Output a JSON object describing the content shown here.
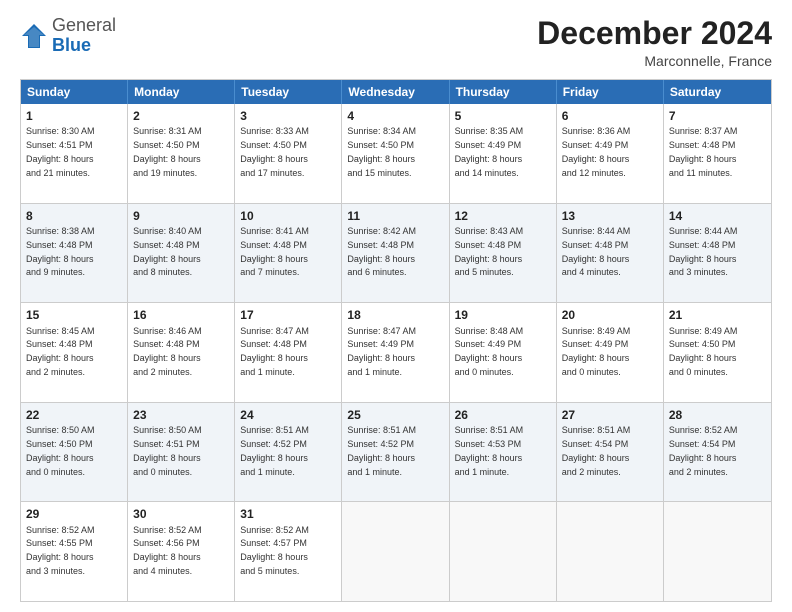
{
  "logo": {
    "general": "General",
    "blue": "Blue"
  },
  "header": {
    "month": "December 2024",
    "location": "Marconnelle, France"
  },
  "weekdays": [
    "Sunday",
    "Monday",
    "Tuesday",
    "Wednesday",
    "Thursday",
    "Friday",
    "Saturday"
  ],
  "rows": [
    [
      {
        "day": "1",
        "text": "Sunrise: 8:30 AM\nSunset: 4:51 PM\nDaylight: 8 hours\nand 21 minutes.",
        "shaded": false
      },
      {
        "day": "2",
        "text": "Sunrise: 8:31 AM\nSunset: 4:50 PM\nDaylight: 8 hours\nand 19 minutes.",
        "shaded": false
      },
      {
        "day": "3",
        "text": "Sunrise: 8:33 AM\nSunset: 4:50 PM\nDaylight: 8 hours\nand 17 minutes.",
        "shaded": false
      },
      {
        "day": "4",
        "text": "Sunrise: 8:34 AM\nSunset: 4:50 PM\nDaylight: 8 hours\nand 15 minutes.",
        "shaded": false
      },
      {
        "day": "5",
        "text": "Sunrise: 8:35 AM\nSunset: 4:49 PM\nDaylight: 8 hours\nand 14 minutes.",
        "shaded": false
      },
      {
        "day": "6",
        "text": "Sunrise: 8:36 AM\nSunset: 4:49 PM\nDaylight: 8 hours\nand 12 minutes.",
        "shaded": false
      },
      {
        "day": "7",
        "text": "Sunrise: 8:37 AM\nSunset: 4:48 PM\nDaylight: 8 hours\nand 11 minutes.",
        "shaded": false
      }
    ],
    [
      {
        "day": "8",
        "text": "Sunrise: 8:38 AM\nSunset: 4:48 PM\nDaylight: 8 hours\nand 9 minutes.",
        "shaded": true
      },
      {
        "day": "9",
        "text": "Sunrise: 8:40 AM\nSunset: 4:48 PM\nDaylight: 8 hours\nand 8 minutes.",
        "shaded": true
      },
      {
        "day": "10",
        "text": "Sunrise: 8:41 AM\nSunset: 4:48 PM\nDaylight: 8 hours\nand 7 minutes.",
        "shaded": true
      },
      {
        "day": "11",
        "text": "Sunrise: 8:42 AM\nSunset: 4:48 PM\nDaylight: 8 hours\nand 6 minutes.",
        "shaded": true
      },
      {
        "day": "12",
        "text": "Sunrise: 8:43 AM\nSunset: 4:48 PM\nDaylight: 8 hours\nand 5 minutes.",
        "shaded": true
      },
      {
        "day": "13",
        "text": "Sunrise: 8:44 AM\nSunset: 4:48 PM\nDaylight: 8 hours\nand 4 minutes.",
        "shaded": true
      },
      {
        "day": "14",
        "text": "Sunrise: 8:44 AM\nSunset: 4:48 PM\nDaylight: 8 hours\nand 3 minutes.",
        "shaded": true
      }
    ],
    [
      {
        "day": "15",
        "text": "Sunrise: 8:45 AM\nSunset: 4:48 PM\nDaylight: 8 hours\nand 2 minutes.",
        "shaded": false
      },
      {
        "day": "16",
        "text": "Sunrise: 8:46 AM\nSunset: 4:48 PM\nDaylight: 8 hours\nand 2 minutes.",
        "shaded": false
      },
      {
        "day": "17",
        "text": "Sunrise: 8:47 AM\nSunset: 4:48 PM\nDaylight: 8 hours\nand 1 minute.",
        "shaded": false
      },
      {
        "day": "18",
        "text": "Sunrise: 8:47 AM\nSunset: 4:49 PM\nDaylight: 8 hours\nand 1 minute.",
        "shaded": false
      },
      {
        "day": "19",
        "text": "Sunrise: 8:48 AM\nSunset: 4:49 PM\nDaylight: 8 hours\nand 0 minutes.",
        "shaded": false
      },
      {
        "day": "20",
        "text": "Sunrise: 8:49 AM\nSunset: 4:49 PM\nDaylight: 8 hours\nand 0 minutes.",
        "shaded": false
      },
      {
        "day": "21",
        "text": "Sunrise: 8:49 AM\nSunset: 4:50 PM\nDaylight: 8 hours\nand 0 minutes.",
        "shaded": false
      }
    ],
    [
      {
        "day": "22",
        "text": "Sunrise: 8:50 AM\nSunset: 4:50 PM\nDaylight: 8 hours\nand 0 minutes.",
        "shaded": true
      },
      {
        "day": "23",
        "text": "Sunrise: 8:50 AM\nSunset: 4:51 PM\nDaylight: 8 hours\nand 0 minutes.",
        "shaded": true
      },
      {
        "day": "24",
        "text": "Sunrise: 8:51 AM\nSunset: 4:52 PM\nDaylight: 8 hours\nand 1 minute.",
        "shaded": true
      },
      {
        "day": "25",
        "text": "Sunrise: 8:51 AM\nSunset: 4:52 PM\nDaylight: 8 hours\nand 1 minute.",
        "shaded": true
      },
      {
        "day": "26",
        "text": "Sunrise: 8:51 AM\nSunset: 4:53 PM\nDaylight: 8 hours\nand 1 minute.",
        "shaded": true
      },
      {
        "day": "27",
        "text": "Sunrise: 8:51 AM\nSunset: 4:54 PM\nDaylight: 8 hours\nand 2 minutes.",
        "shaded": true
      },
      {
        "day": "28",
        "text": "Sunrise: 8:52 AM\nSunset: 4:54 PM\nDaylight: 8 hours\nand 2 minutes.",
        "shaded": true
      }
    ],
    [
      {
        "day": "29",
        "text": "Sunrise: 8:52 AM\nSunset: 4:55 PM\nDaylight: 8 hours\nand 3 minutes.",
        "shaded": false
      },
      {
        "day": "30",
        "text": "Sunrise: 8:52 AM\nSunset: 4:56 PM\nDaylight: 8 hours\nand 4 minutes.",
        "shaded": false
      },
      {
        "day": "31",
        "text": "Sunrise: 8:52 AM\nSunset: 4:57 PM\nDaylight: 8 hours\nand 5 minutes.",
        "shaded": false
      },
      {
        "day": "",
        "text": "",
        "shaded": false,
        "empty": true
      },
      {
        "day": "",
        "text": "",
        "shaded": false,
        "empty": true
      },
      {
        "day": "",
        "text": "",
        "shaded": false,
        "empty": true
      },
      {
        "day": "",
        "text": "",
        "shaded": false,
        "empty": true
      }
    ]
  ]
}
